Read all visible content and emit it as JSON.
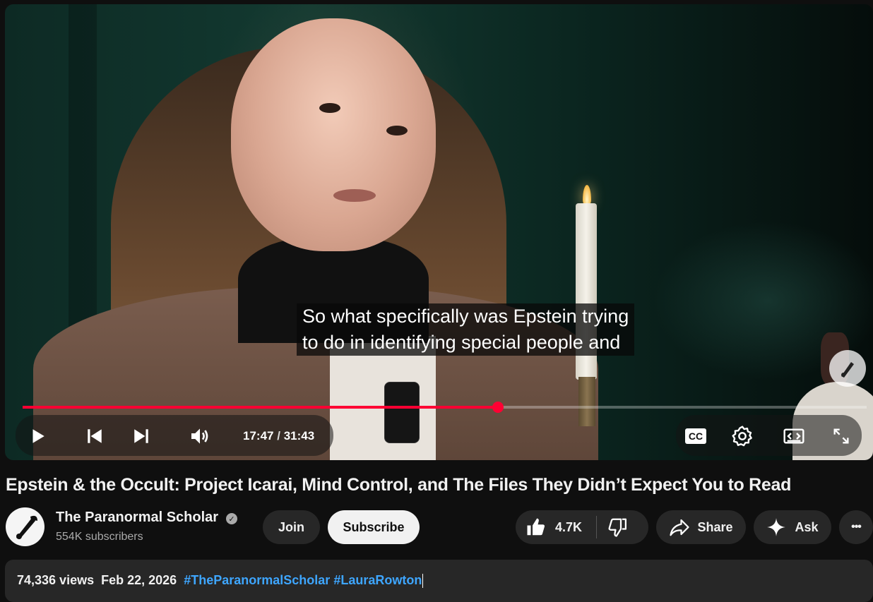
{
  "player": {
    "caption_line1": "So what specifically was Epstein trying",
    "caption_line2": "to do in identifying special people and",
    "current_time": "17:47",
    "separator": "/",
    "duration": "31:43",
    "progress_fraction": 0.5633,
    "icons": [
      "play-icon",
      "previous-icon",
      "next-icon",
      "volume-icon",
      "closed-captions-icon",
      "settings-icon",
      "theater-mode-icon",
      "fullscreen-icon"
    ],
    "cc_label": "CC",
    "accent_color": "#ff0033"
  },
  "video": {
    "title": "Epstein & the Occult: Project Icarai, Mind Control, and The Files They Didn’t Expect You to Read"
  },
  "channel": {
    "name": "The Paranormal Scholar",
    "verified_mark": "✓",
    "subscribers": "554K subscribers",
    "join_label": "Join",
    "subscribe_label": "Subscribe"
  },
  "actions": {
    "like_count": "4.7K",
    "share_label": "Share",
    "ask_label": "Ask",
    "more_label": "•••"
  },
  "description": {
    "views": "74,336 views",
    "date": "Feb 22, 2026",
    "hashtag1": "#TheParanormalScholar",
    "hashtag2": "#LauraRowton"
  }
}
